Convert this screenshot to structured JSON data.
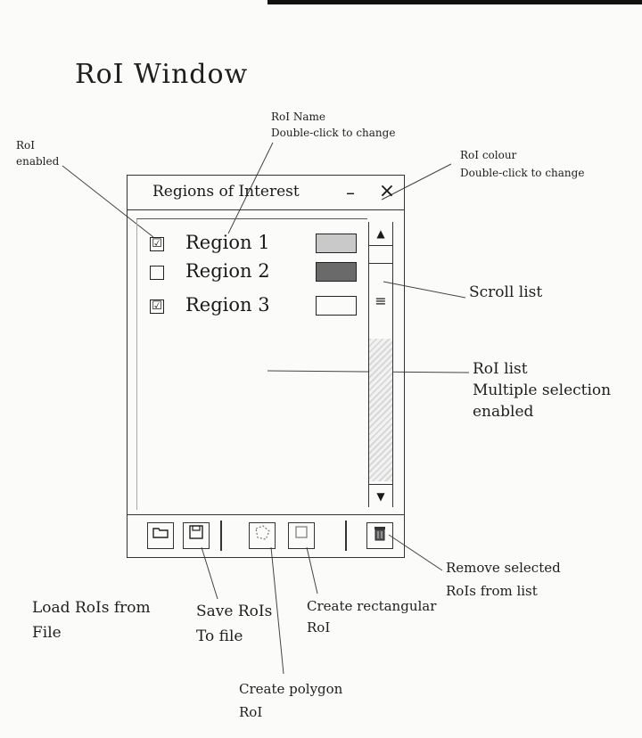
{
  "heading": "RoI Window",
  "window": {
    "title": "Regions of Interest",
    "minimize_glyph": "–",
    "close_glyph": "×",
    "regions": [
      {
        "name": "Region  1",
        "checked": true,
        "colour": "#c9c9c9",
        "checkbox_glyph": "☑"
      },
      {
        "name": "Region  2",
        "checked": false,
        "colour": "#6a6a6a",
        "checkbox_glyph": ""
      },
      {
        "name": "Region  3",
        "checked": true,
        "colour": "#fbfbf9",
        "checkbox_glyph": "☑"
      }
    ],
    "scroll_up_glyph": "▲",
    "scroll_down_glyph": "▼",
    "scroll_grip_glyph": "≡",
    "toolbar": {
      "load_icon": "folder-icon",
      "save_icon": "floppy-disk-icon",
      "polygon_icon": "polygon-icon",
      "rectangle_icon": "rectangle-icon",
      "remove_icon": "trash-icon"
    }
  },
  "annotations": {
    "roi_enabled": "RoI\nenabled",
    "roi_name": "RoI Name\nDouble-click to change",
    "roi_colour": "RoI colour\nDouble-click to change",
    "scroll_list": "Scroll list",
    "roi_list": "RoI list\nMultiple selection\nenabled",
    "remove_selected": "Remove selected\nRoIs  from list",
    "load_rois": "Load RoIs from\nFile",
    "save_rois": "Save RoIs\nTo file",
    "create_rectangular": "Create rectangular\nRoI",
    "create_polygon": "Create polygon\nRoI"
  }
}
